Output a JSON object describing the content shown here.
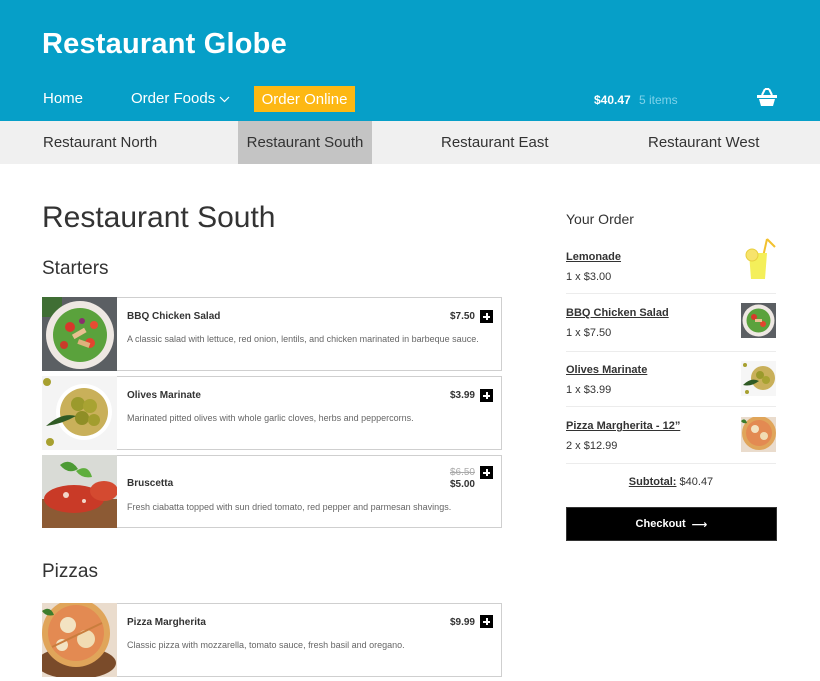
{
  "header": {
    "brand": "Restaurant Globe",
    "nav": {
      "home": "Home",
      "order_foods": "Order Foods",
      "order_online": "Order Online"
    },
    "cart": {
      "total": "$40.47",
      "count": "5 items",
      "icon": "basket-icon"
    },
    "colors": {
      "header_bg": "#069fc8",
      "accent": "#fdb813"
    }
  },
  "subnav": {
    "items": [
      {
        "label": "Restaurant North",
        "active": false
      },
      {
        "label": "Restaurant South",
        "active": true
      },
      {
        "label": "Restaurant East",
        "active": false
      },
      {
        "label": "Restaurant West",
        "active": false
      }
    ]
  },
  "main": {
    "title": "Restaurant South",
    "sections": [
      {
        "title": "Starters",
        "items": [
          {
            "name": "BBQ Chicken Salad",
            "price": "$7.50",
            "description": "A classic salad with lettuce, red onion, lentils, and chicken marinated in barbeque sauce.",
            "image": "salad"
          },
          {
            "name": "Olives Marinate",
            "price": "$3.99",
            "description": "Marinated pitted olives with whole garlic cloves, herbs and peppercorns.",
            "image": "olives"
          },
          {
            "name": "Bruscetta",
            "old_price": "$6.50",
            "price": "$5.00",
            "description": "Fresh ciabatta topped with sun dried tomato, red pepper and parmesan shavings.",
            "image": "bruschetta"
          }
        ]
      },
      {
        "title": "Pizzas",
        "items": [
          {
            "name": "Pizza Margherita",
            "price": "$9.99",
            "description": "Classic pizza with mozzarella, tomato sauce, fresh basil and oregano.",
            "image": "pizza"
          }
        ]
      }
    ]
  },
  "order": {
    "title": "Your Order",
    "items": [
      {
        "name": "Lemonade",
        "qty": "1 x $3.00",
        "image": "lemonade"
      },
      {
        "name": "BBQ Chicken Salad",
        "qty": "1 x $7.50",
        "image": "salad"
      },
      {
        "name": "Olives Marinate",
        "qty": "1 x $3.99",
        "image": "olives"
      },
      {
        "name": "Pizza Margherita - 12”",
        "qty": "2 x $12.99",
        "image": "pizza"
      }
    ],
    "subtotal_label": "Subtotal:",
    "subtotal_value": "$40.47",
    "checkout_label": "Checkout",
    "checkout_arrow": "⟶"
  }
}
